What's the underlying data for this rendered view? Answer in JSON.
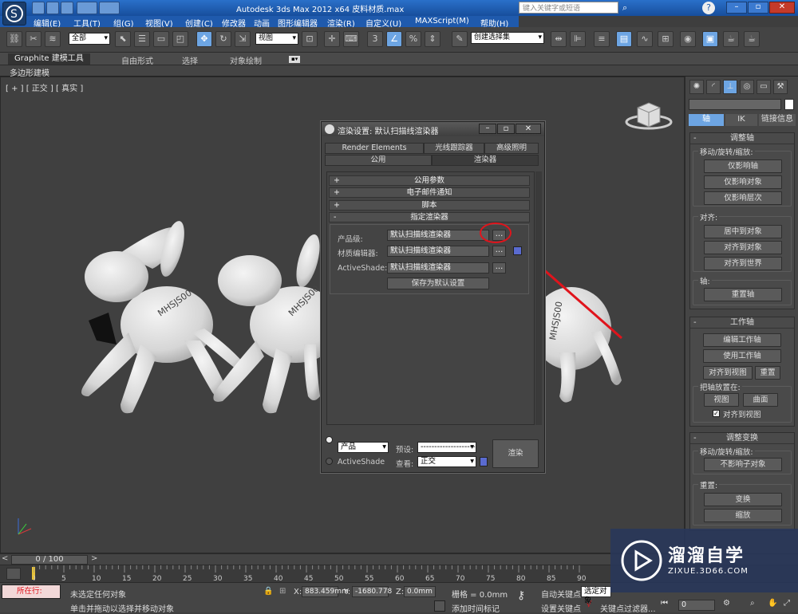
{
  "window": {
    "title": "Autodesk 3ds Max  2012 x64     皮料材质.max",
    "search_placeholder": "键入关键字或短语"
  },
  "menu": [
    "编辑(E)",
    "工具(T)",
    "组(G)",
    "视图(V)",
    "创建(C)",
    "修改器",
    "动画",
    "图形编辑器",
    "渲染(R)",
    "自定义(U)",
    "MAXScript(M)",
    "帮助(H)"
  ],
  "toolbar": {
    "selection_filter": "全部",
    "ref_coord": "视图",
    "named_selection": "创建选择集"
  },
  "ribbon": {
    "tabs": [
      "Graphite 建模工具",
      "自由形式",
      "选择",
      "对象绘制"
    ],
    "sub": "多边形建模"
  },
  "viewport": {
    "label": "[ + ] [ 正交 ] [ 真实 ]",
    "model_text": "MHSJS00"
  },
  "command_panel": {
    "tabs": [
      "轴",
      "IK",
      "链接信息"
    ],
    "adjust_pivot": {
      "title": "调整轴",
      "move_rotate_scale": "移动/旋转/缩放:",
      "buttons": [
        "仅影响轴",
        "仅影响对象",
        "仅影响层次"
      ],
      "align": "对齐:",
      "align_buttons": [
        "居中到对象",
        "对齐到对象",
        "对齐到世界"
      ],
      "pivot": "轴:",
      "reset_pivot": "重置轴"
    },
    "working_pivot": {
      "title": "工作轴",
      "buttons": [
        "编辑工作轴",
        "使用工作轴"
      ],
      "align_to_view": "对齐到视图",
      "reset": "重置",
      "place_pivot_to": "把轴放置在:",
      "view": "视图",
      "surface": "曲面",
      "align_to_view_check": "对齐到视图"
    },
    "adjust_transform": {
      "title": "调整变换",
      "move_rotate_scale": "移动/旋转/缩放:",
      "dont_affect_children": "不影响子对象",
      "reset": "重置:",
      "transform": "变换",
      "scale": "缩放"
    }
  },
  "dialog": {
    "title": "渲染设置: 默认扫描线渲染器",
    "tabs_row1": [
      "Render Elements",
      "光线跟踪器",
      "高级照明"
    ],
    "tabs_row2": [
      "公用",
      "渲染器"
    ],
    "rollouts": [
      {
        "sign": "+",
        "label": "公用参数"
      },
      {
        "sign": "+",
        "label": "电子邮件通知"
      },
      {
        "sign": "+",
        "label": "脚本"
      },
      {
        "sign": "-",
        "label": "指定渲染器"
      }
    ],
    "production_label": "产品级:",
    "production_value": "默认扫描线渲染器",
    "material_editor_label": "材质编辑器:",
    "material_editor_value": "默认扫描线渲染器",
    "activeshade_label": "ActiveShade:",
    "activeshade_value": "默认扫描线渲染器",
    "dots": "...",
    "save_default": "保存为默认设置",
    "mode_production": "产品",
    "mode_activeshade": "ActiveShade",
    "preset_label": "预设:",
    "preset_value": "--------------------",
    "view_label": "查看:",
    "view_value": "正交",
    "render_button": "渲染"
  },
  "timeline": {
    "frame": "0 / 100",
    "ticks": [
      "0",
      "5",
      "10",
      "15",
      "20",
      "25",
      "30",
      "35",
      "40",
      "45",
      "50",
      "55",
      "60",
      "65",
      "70",
      "75",
      "80",
      "85",
      "90"
    ]
  },
  "status": {
    "running": "所在行:",
    "selection": "未选定任何对象",
    "hint": "单击并拖动以选择并移动对象",
    "x_label": "X:",
    "x_value": "883.459mm",
    "y_label": "Y:",
    "y_value": "-1680.778",
    "z_label": "Z:",
    "z_value": "0.0mm",
    "grid": "栅格 = 0.0mm",
    "add_time_tag": "添加时间标记",
    "auto_key": "自动关键点",
    "selected": "选定对象",
    "set_key": "设置关键点",
    "key_filters": "关键点过滤器...",
    "frame_value": "0"
  },
  "watermark": {
    "brand": "溜溜自学",
    "url": "ZIXUE.3D66.COM"
  },
  "colors": {
    "highlight_red": "#e0141c",
    "title_blue": "#1f5aad",
    "accent_blue": "#6da5e3"
  }
}
